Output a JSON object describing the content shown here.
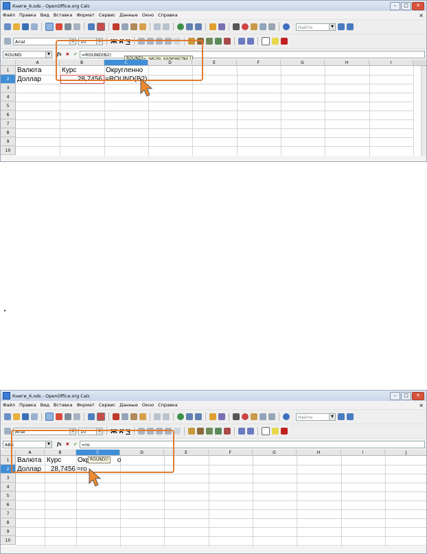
{
  "top": {
    "window_title": "Книги_6.ods - OpenOffice.org Calc",
    "menu": [
      "Файл",
      "Правка",
      "Вид",
      "Вставка",
      "Формат",
      "Сервис",
      "Данные",
      "Окно",
      "Справка"
    ],
    "find_placeholder": "Найти",
    "font_name": "Arial",
    "font_size": "10",
    "name_box": "ROUND",
    "formula": "=ROUND(B2)",
    "tooltip": "ROUND(← число; количество )",
    "columns": [
      "A",
      "B",
      "C",
      "D",
      "E",
      "F",
      "G",
      "H",
      "I"
    ],
    "rows": [
      "1",
      "2",
      "3",
      "4",
      "5",
      "6",
      "7",
      "8",
      "9",
      "10"
    ],
    "cells": {
      "a1": "Валюта",
      "b1": "Курс",
      "c1": "Округленно",
      "a2": "Доллар",
      "b2": "28,7456",
      "c2": "=ROUND(B2)"
    }
  },
  "bullet": "•",
  "bottom": {
    "window_title": "Книги_6.ods - OpenOffice.org Calc",
    "menu": [
      "Файл",
      "Правка",
      "Вид",
      "Вставка",
      "Формат",
      "Сервис",
      "Данные",
      "Окно",
      "Справка"
    ],
    "find_placeholder": "Найти",
    "font_name": "Arial",
    "font_size": "10",
    "name_box": "ABS",
    "formula": "=ro",
    "tooltip": "ROUND()",
    "columns": [
      "A",
      "B",
      "C",
      "D",
      "E",
      "F",
      "G",
      "H",
      "I",
      "J"
    ],
    "rows": [
      "1",
      "2",
      "3",
      "4",
      "5",
      "6",
      "7",
      "8",
      "9",
      "10"
    ],
    "cells": {
      "a1": "Валюта",
      "b1": "Курс",
      "c1_prefix": "Окр",
      "c1_suffix": "о",
      "a2": "Доллар",
      "b2": "28,7456",
      "c2": "=ro"
    }
  },
  "colors": {
    "highlight_border": "#e07a2e",
    "selection": "#3f8ed8",
    "error_cell_border": "#e05050"
  }
}
